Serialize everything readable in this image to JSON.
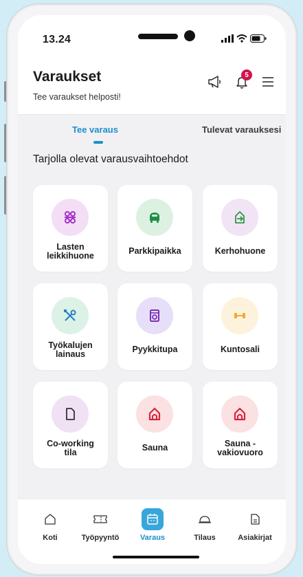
{
  "status_bar": {
    "time": "13.24"
  },
  "header": {
    "title": "Varaukset",
    "subtitle": "Tee varaukset helposti!",
    "notification_count": "5",
    "icons": [
      "megaphone-icon",
      "bell-icon",
      "menu-icon"
    ]
  },
  "tabs": {
    "active": "Tee varaus",
    "inactive": "Tulevat varauksesi"
  },
  "section_title": "Tarjolla olevat varausvaihtoehdot",
  "tiles": [
    {
      "line1": "Lasten",
      "line2": "leikkihuone",
      "icon": "toys-icon",
      "icon_color": "#a52fc4",
      "bg": "#f3def6"
    },
    {
      "line1": "Parkkipaikka",
      "line2": "",
      "icon": "car-icon",
      "icon_color": "#1f8f44",
      "bg": "#ddf1e3"
    },
    {
      "line1": "Kerhohuone",
      "line2": "",
      "icon": "enter-room-icon",
      "icon_color": "#2a9a46",
      "bg": "#f1e4f5"
    },
    {
      "line1": "Työkalujen",
      "line2": "lainaus",
      "icon": "tools-icon",
      "icon_color": "#2b7fc4",
      "bg": "#dcf2e6"
    },
    {
      "line1": "Pyykkitupa",
      "line2": "",
      "icon": "washing-machine-icon",
      "icon_color": "#7b2fb6",
      "bg": "#e7defa"
    },
    {
      "line1": "Kuntosali",
      "line2": "",
      "icon": "dumbbell-icon",
      "icon_color": "#f0a93a",
      "bg": "#fdf3dc"
    },
    {
      "line1": "Co-working",
      "line2": "tila",
      "icon": "document-icon",
      "icon_color": "#333333",
      "bg": "#f0e1f5"
    },
    {
      "line1": "Sauna",
      "line2": "",
      "icon": "sauna-icon",
      "icon_color": "#d8243e",
      "bg": "#fbe1e2"
    },
    {
      "line1": "Sauna -",
      "line2": "vakiovuoro",
      "icon": "sauna-icon",
      "icon_color": "#d8243e",
      "bg": "#fbe1e2"
    }
  ],
  "bottom_nav": [
    {
      "label": "Koti",
      "icon": "home-icon"
    },
    {
      "label": "Työpyyntö",
      "icon": "ticket-icon"
    },
    {
      "label": "Varaus",
      "icon": "calendar-icon",
      "active": true
    },
    {
      "label": "Tilaus",
      "icon": "cloche-icon"
    },
    {
      "label": "Asiakirjat",
      "icon": "document-icon"
    }
  ],
  "colors": {
    "accent": "#1d8fcc",
    "nav_active_bg": "#39a6db",
    "badge": "#d0134a",
    "background": "#d3edf6"
  }
}
